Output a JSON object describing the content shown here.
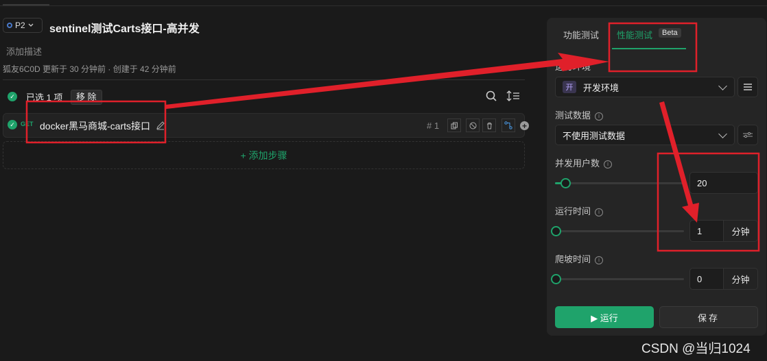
{
  "header": {
    "priority": "P2",
    "title": "sentinel测试Carts接口-高并发",
    "description_placeholder": "添加描述",
    "meta": "狐友6C0D 更新于 30 分钟前 · 创建于 42 分钟前"
  },
  "selection": {
    "text": "已选 1 项",
    "remove_label": "移 除"
  },
  "steps": [
    {
      "method": "GET",
      "name": "docker黑马商城-carts接口",
      "index": "# 1"
    }
  ],
  "add_step_label": "+ 添加步骤",
  "panel": {
    "tabs": [
      {
        "label": "功能测试"
      },
      {
        "label": "性能测试",
        "badge": "Beta"
      }
    ],
    "env_label": "运行环境",
    "env_badge": "开",
    "env_value": "开发环境",
    "test_data_label": "测试数据",
    "test_data_value": "不使用测试数据",
    "concurrency_label": "并发用户数",
    "concurrency_value": "20",
    "concurrency_fraction": 0.08,
    "duration_label": "运行时间",
    "duration_value": "1",
    "duration_unit": "分钟",
    "rampup_label": "爬坡时间",
    "rampup_value": "0",
    "rampup_unit": "分钟",
    "run_label": "▶ 运行",
    "save_label": "保存"
  },
  "watermark": "CSDN @当归1024",
  "colors": {
    "accent": "#1fa36b",
    "annotation": "#e0202a"
  }
}
